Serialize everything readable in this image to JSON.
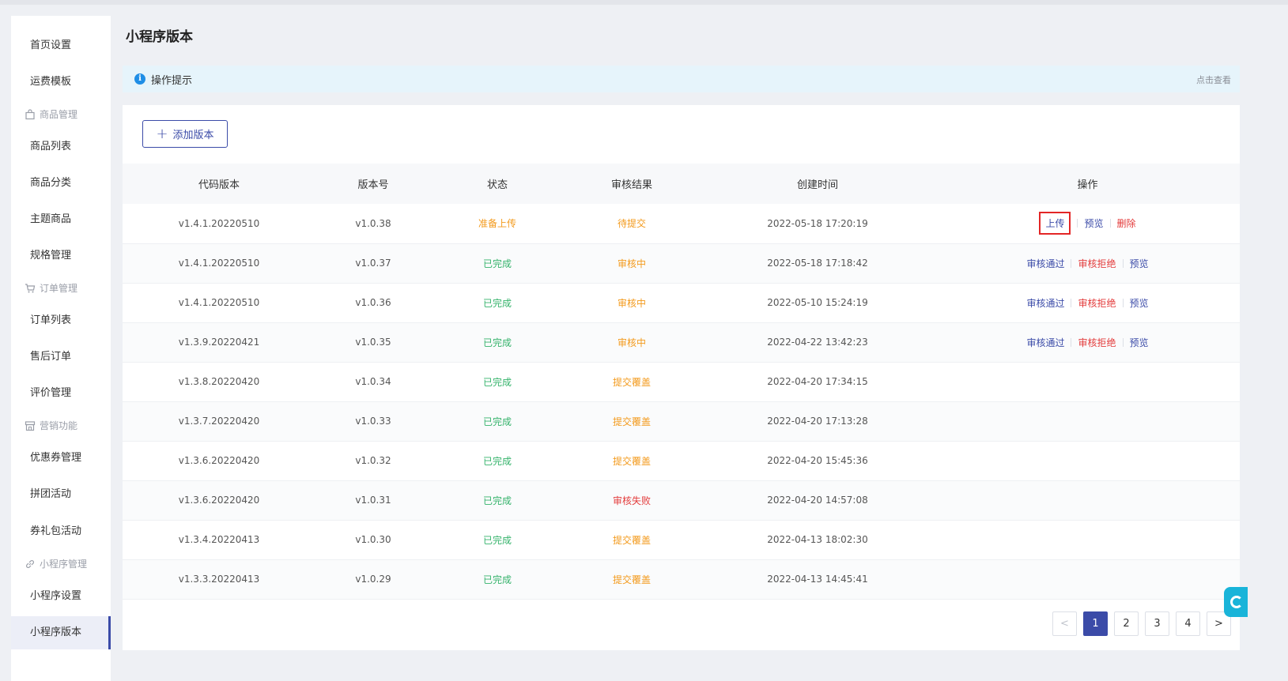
{
  "sidebar": {
    "items": [
      {
        "label": "首页设置",
        "type": "item"
      },
      {
        "label": "运费模板",
        "type": "item"
      },
      {
        "label": "商品管理",
        "type": "group",
        "icon": "bag-icon"
      },
      {
        "label": "商品列表",
        "type": "item"
      },
      {
        "label": "商品分类",
        "type": "item"
      },
      {
        "label": "主题商品",
        "type": "item"
      },
      {
        "label": "规格管理",
        "type": "item"
      },
      {
        "label": "订单管理",
        "type": "group",
        "icon": "cart-icon"
      },
      {
        "label": "订单列表",
        "type": "item"
      },
      {
        "label": "售后订单",
        "type": "item"
      },
      {
        "label": "评价管理",
        "type": "item"
      },
      {
        "label": "营销功能",
        "type": "group",
        "icon": "store-icon"
      },
      {
        "label": "优惠券管理",
        "type": "item"
      },
      {
        "label": "拼团活动",
        "type": "item"
      },
      {
        "label": "券礼包活动",
        "type": "item"
      },
      {
        "label": "小程序管理",
        "type": "group",
        "icon": "link-icon"
      },
      {
        "label": "小程序设置",
        "type": "item"
      },
      {
        "label": "小程序版本",
        "type": "item",
        "active": true
      }
    ]
  },
  "page": {
    "title": "小程序版本",
    "tip": {
      "text": "操作提示",
      "link": "点击查看"
    },
    "add_button": "添加版本"
  },
  "table": {
    "headers": [
      "代码版本",
      "版本号",
      "状态",
      "审核结果",
      "创建时间",
      "操作"
    ],
    "rows": [
      {
        "code": "v1.4.1.20220510",
        "version": "v1.0.38",
        "status": "准备上传",
        "status_color": "orange",
        "review": "待提交",
        "review_color": "orange",
        "created": "2022-05-18 17:20:19",
        "ops": [
          {
            "label": "上传",
            "color": "blue",
            "highlight": true
          },
          {
            "label": "预览",
            "color": "blue"
          },
          {
            "label": "删除",
            "color": "red"
          }
        ]
      },
      {
        "code": "v1.4.1.20220510",
        "version": "v1.0.37",
        "status": "已完成",
        "status_color": "green",
        "review": "审核中",
        "review_color": "orange",
        "created": "2022-05-18 17:18:42",
        "ops": [
          {
            "label": "审核通过",
            "color": "blue"
          },
          {
            "label": "审核拒绝",
            "color": "red"
          },
          {
            "label": "预览",
            "color": "blue"
          }
        ]
      },
      {
        "code": "v1.4.1.20220510",
        "version": "v1.0.36",
        "status": "已完成",
        "status_color": "green",
        "review": "审核中",
        "review_color": "orange",
        "created": "2022-05-10 15:24:19",
        "ops": [
          {
            "label": "审核通过",
            "color": "blue"
          },
          {
            "label": "审核拒绝",
            "color": "red"
          },
          {
            "label": "预览",
            "color": "blue"
          }
        ]
      },
      {
        "code": "v1.3.9.20220421",
        "version": "v1.0.35",
        "status": "已完成",
        "status_color": "green",
        "review": "审核中",
        "review_color": "orange",
        "created": "2022-04-22 13:42:23",
        "ops": [
          {
            "label": "审核通过",
            "color": "blue"
          },
          {
            "label": "审核拒绝",
            "color": "red"
          },
          {
            "label": "预览",
            "color": "blue"
          }
        ]
      },
      {
        "code": "v1.3.8.20220420",
        "version": "v1.0.34",
        "status": "已完成",
        "status_color": "green",
        "review": "提交覆盖",
        "review_color": "orange",
        "created": "2022-04-20 17:34:15",
        "ops": []
      },
      {
        "code": "v1.3.7.20220420",
        "version": "v1.0.33",
        "status": "已完成",
        "status_color": "green",
        "review": "提交覆盖",
        "review_color": "orange",
        "created": "2022-04-20 17:13:28",
        "ops": []
      },
      {
        "code": "v1.3.6.20220420",
        "version": "v1.0.32",
        "status": "已完成",
        "status_color": "green",
        "review": "提交覆盖",
        "review_color": "orange",
        "created": "2022-04-20 15:45:36",
        "ops": []
      },
      {
        "code": "v1.3.6.20220420",
        "version": "v1.0.31",
        "status": "已完成",
        "status_color": "green",
        "review": "审核失败",
        "review_color": "red",
        "created": "2022-04-20 14:57:08",
        "ops": []
      },
      {
        "code": "v1.3.4.20220413",
        "version": "v1.0.30",
        "status": "已完成",
        "status_color": "green",
        "review": "提交覆盖",
        "review_color": "orange",
        "created": "2022-04-13 18:02:30",
        "ops": []
      },
      {
        "code": "v1.3.3.20220413",
        "version": "v1.0.29",
        "status": "已完成",
        "status_color": "green",
        "review": "提交覆盖",
        "review_color": "orange",
        "created": "2022-04-13 14:45:41",
        "ops": []
      }
    ]
  },
  "pagination": {
    "prev": "<",
    "pages": [
      "1",
      "2",
      "3",
      "4"
    ],
    "current": "1",
    "next": ">"
  },
  "colors": {
    "primary": "#3b4ba8",
    "green": "#35b36b",
    "orange": "#f39a1c",
    "red": "#e33b3b",
    "highlight_box": "#e32626"
  }
}
